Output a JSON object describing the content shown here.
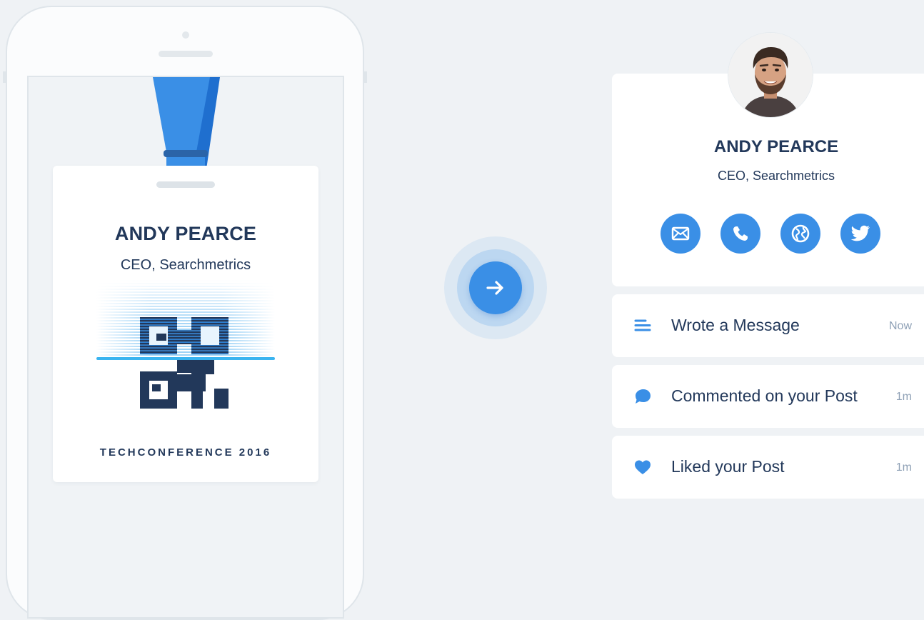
{
  "colors": {
    "accent": "#3a8fe6",
    "accent_dark": "#1f6fcf",
    "text_dark": "#22385a",
    "text_muted": "#8fa1b6",
    "background": "#eff2f5",
    "card": "#ffffff"
  },
  "badge": {
    "name": "ANDY PEARCE",
    "role": "CEO, Searchmetrics",
    "event": "TECHCONFERENCE 2016"
  },
  "transition": {
    "icon": "arrow-right-icon"
  },
  "profile": {
    "name": "ANDY PEARCE",
    "role": "CEO, Searchmetrics",
    "avatar_icon": "person-avatar",
    "socials": [
      {
        "icon": "mail-icon"
      },
      {
        "icon": "phone-icon"
      },
      {
        "icon": "globe-icon"
      },
      {
        "icon": "twitter-icon"
      }
    ]
  },
  "activity": [
    {
      "icon": "message-lines-icon",
      "text": "Wrote a Message",
      "time": "Now"
    },
    {
      "icon": "comment-bubble-icon",
      "text": "Commented on your Post",
      "time": "1m"
    },
    {
      "icon": "heart-icon",
      "text": "Liked your Post",
      "time": "1m"
    }
  ]
}
